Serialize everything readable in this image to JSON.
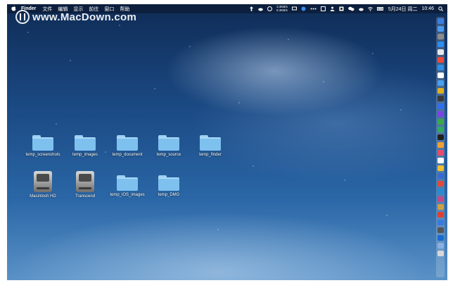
{
  "menubar": {
    "apple_icon": "apple-icon",
    "app_name": "Finder",
    "menus": [
      "文件",
      "编辑",
      "显示",
      "前往",
      "窗口",
      "帮助"
    ],
    "net_up": "3.3KB/s",
    "net_down": "8.3KB/s",
    "date": "5月24日 周二",
    "time": "10:46",
    "status_icons": [
      "upload-icon",
      "cloud-icon",
      "gauge-icon",
      "display-icon",
      "blue-circle-icon",
      "more-dots-icon",
      "monitor-icon",
      "person-icon",
      "screenshot-icon",
      "wechat-icon",
      "cloud-icon",
      "wifi-icon",
      "battery-icon",
      "search-icon"
    ]
  },
  "watermark": {
    "text": "www.MacDown.com"
  },
  "desktop_items": [
    {
      "label": "temp_screenshots",
      "type": "folder"
    },
    {
      "label": "temp_images",
      "type": "folder"
    },
    {
      "label": "temp_document",
      "type": "folder"
    },
    {
      "label": "temp_source",
      "type": "folder"
    },
    {
      "label": "temp_finder",
      "type": "folder"
    },
    {
      "label": "Macintosh HD",
      "type": "disk"
    },
    {
      "label": "Transcend",
      "type": "disk"
    },
    {
      "label": "temp_iOS_images",
      "type": "folder"
    },
    {
      "label": "temp_DMG",
      "type": "folder"
    }
  ],
  "dock_colors": [
    "#3d7de0",
    "#4a9bf0",
    "#8c8c8c",
    "#2c8ef0",
    "#e8e8e8",
    "#f04a3a",
    "#2e8fe6",
    "#ffffff",
    "#4aa0f0",
    "#e0b020",
    "#3a3a3a",
    "#2e6ff0",
    "#7a44e0",
    "#3aa84a",
    "#30a860",
    "#202020",
    "#f0a030",
    "#e84a6a",
    "#ffffff",
    "#f0c030",
    "#3a6ad0",
    "#e04a3a",
    "#2a8ad0",
    "#c04a8a",
    "#d0a040",
    "#e04030",
    "#3a7ae0",
    "#555555",
    "#1a6ad0",
    "#8ab0e0",
    "#d8d8d8"
  ]
}
